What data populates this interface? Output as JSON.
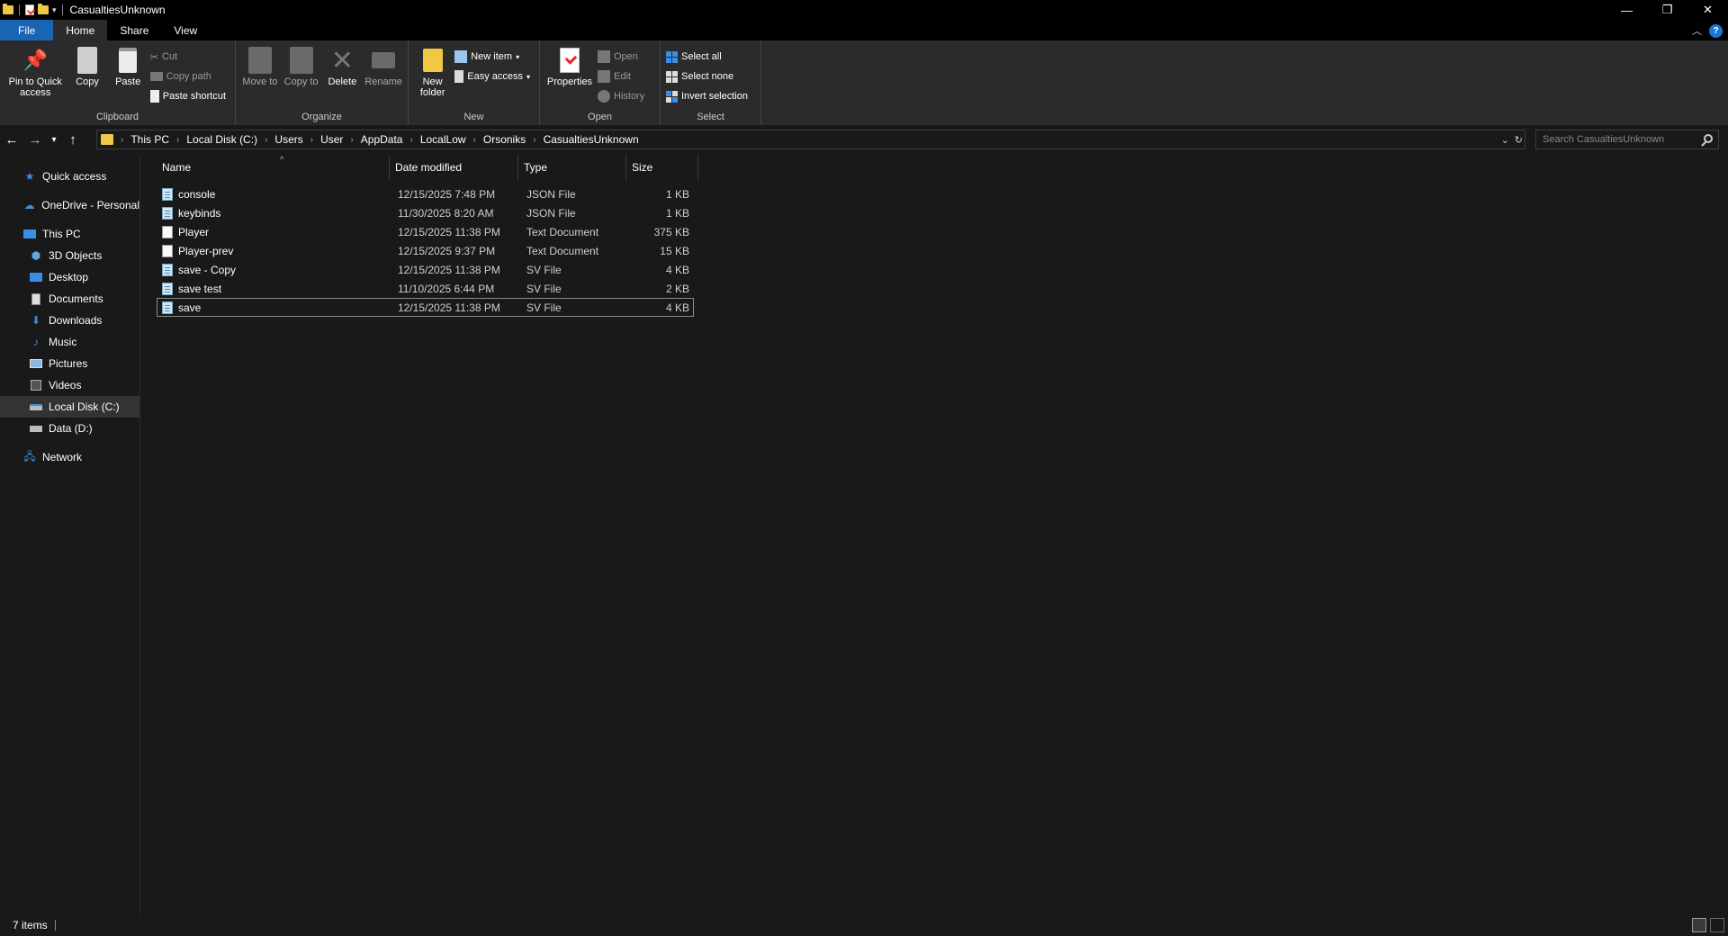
{
  "window": {
    "title": "CasualtiesUnknown",
    "minimize": "—",
    "restore": "❐",
    "close": "✕",
    "help": "?"
  },
  "ribbon_tabs": [
    "File",
    "Home",
    "Share",
    "View"
  ],
  "ribbon": {
    "clipboard": {
      "label": "Clipboard",
      "pin": "Pin to Quick access",
      "copy": "Copy",
      "paste": "Paste",
      "cut": "Cut",
      "copy_path": "Copy path",
      "paste_shortcut": "Paste shortcut"
    },
    "organize": {
      "label": "Organize",
      "move_to": "Move to",
      "copy_to": "Copy to",
      "delete": "Delete",
      "rename": "Rename"
    },
    "new": {
      "label": "New",
      "new_folder": "New folder",
      "new_item": "New item",
      "easy_access": "Easy access"
    },
    "open": {
      "label": "Open",
      "properties": "Properties",
      "open": "Open",
      "edit": "Edit",
      "history": "History"
    },
    "select": {
      "label": "Select",
      "select_all": "Select all",
      "select_none": "Select none",
      "invert_selection": "Invert selection"
    }
  },
  "breadcrumb": [
    "This PC",
    "Local Disk (C:)",
    "Users",
    "User",
    "AppData",
    "LocalLow",
    "Orsoniks",
    "CasualtiesUnknown"
  ],
  "search": {
    "placeholder": "Search CasualtiesUnknown"
  },
  "nav": {
    "quick_access": "Quick access",
    "onedrive": "OneDrive - Personal",
    "this_pc": "This PC",
    "objects3d": "3D Objects",
    "desktop": "Desktop",
    "documents": "Documents",
    "downloads": "Downloads",
    "music": "Music",
    "pictures": "Pictures",
    "videos": "Videos",
    "local_disk": "Local Disk (C:)",
    "data_d": "Data (D:)",
    "network": "Network"
  },
  "columns": {
    "name": "Name",
    "date": "Date modified",
    "type": "Type",
    "size": "Size"
  },
  "files": [
    {
      "name": "console",
      "date": "12/15/2025 7:48 PM",
      "type": "JSON File",
      "size": "1 KB",
      "icon": "json-file-icon"
    },
    {
      "name": "keybinds",
      "date": "11/30/2025 8:20 AM",
      "type": "JSON File",
      "size": "1 KB",
      "icon": "json-file-icon"
    },
    {
      "name": "Player",
      "date": "12/15/2025 11:38 PM",
      "type": "Text Document",
      "size": "375 KB",
      "icon": "text-file-icon"
    },
    {
      "name": "Player-prev",
      "date": "12/15/2025 9:37 PM",
      "type": "Text Document",
      "size": "15 KB",
      "icon": "text-file-icon"
    },
    {
      "name": "save - Copy",
      "date": "12/15/2025 11:38 PM",
      "type": "SV File",
      "size": "4 KB",
      "icon": "sv-file-icon"
    },
    {
      "name": "save test",
      "date": "11/10/2025 6:44 PM",
      "type": "SV File",
      "size": "2 KB",
      "icon": "sv-file-icon"
    },
    {
      "name": "save",
      "date": "12/15/2025 11:38 PM",
      "type": "SV File",
      "size": "4 KB",
      "icon": "sv-file-icon"
    }
  ],
  "status": {
    "items": "7 items"
  },
  "colors": {
    "accent": "#1a64b4",
    "background": "#191919",
    "ribbon": "#2b2b2b",
    "folder": "#f2c744"
  }
}
